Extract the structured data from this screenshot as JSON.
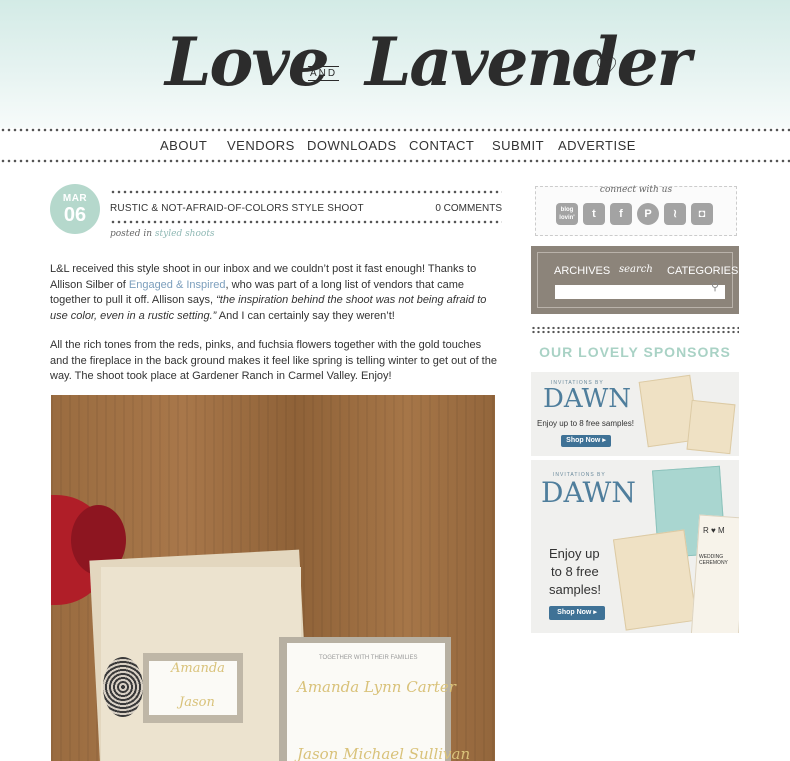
{
  "header": {
    "logo_left": "Love",
    "logo_and": "AND",
    "logo_right": "Lavender"
  },
  "nav": [
    "ABOUT",
    "VENDORS",
    "DOWNLOADS",
    "CONTACT",
    "SUBMIT",
    "ADVERTISE"
  ],
  "post": {
    "date_month": "MAR",
    "date_day": "06",
    "title": "RUSTIC & NOT-AFRAID-OF-COLORS STYLE SHOOT",
    "comments": "0 COMMENTS",
    "posted_in_label": "posted in",
    "category": "styled shoots",
    "p1_a": "L&L received this style shoot in our inbox and we couldn’t post it fast enough!  Thanks to Allison Silber of ",
    "p1_link": "Engaged & Inspired",
    "p1_b": ", who was part of a long list of vendors that came together to pull it off.  Allison says, ",
    "p1_quote": "“the inspiration behind the shoot was not being afraid to use color, even in a rustic setting.”",
    "p1_c": "  And I can certainly say they weren’t!",
    "p2": "All the rich tones from the reds, pinks, and fuchsia flowers together with the gold touches and the fireplace in the back ground makes it feel like spring is telling winter to get out of the way. The shoot took place at Gardener Ranch in Carmel Valley. Enjoy!",
    "photo_text": {
      "tag_name1": "Amanda",
      "tag_name2": "Jason",
      "card_small": "TOGETHER WITH THEIR FAMILIES",
      "card_name1": "Amanda Lynn Carter",
      "card_name2": "Jason Michael Sullivan"
    }
  },
  "sidebar": {
    "connect_title": "connect with us",
    "social": [
      {
        "icon": "bloglovin-icon",
        "glyph": "blog lovin'"
      },
      {
        "icon": "twitter-icon",
        "glyph": "t"
      },
      {
        "icon": "facebook-icon",
        "glyph": "f"
      },
      {
        "icon": "pinterest-icon",
        "glyph": "P"
      },
      {
        "icon": "rss-icon",
        "glyph": "≀"
      },
      {
        "icon": "instagram-icon",
        "glyph": "◘"
      }
    ],
    "tabs": [
      "ARCHIVES",
      "search",
      "CATEGORIES"
    ],
    "sponsors_title": "OUR LOVELY SPONSORS",
    "ad1": {
      "by": "INVITATIONS BY",
      "brand": "DAWN",
      "text": "Enjoy up to 8 free samples!",
      "button": "Shop Now ▸"
    },
    "ad2": {
      "by": "INVITATIONS BY",
      "brand": "DAWN",
      "text_l1": "Enjoy up",
      "text_l2": "to 8 free",
      "text_l3": "samples!",
      "button": "Shop Now ▸",
      "card_text_rm": "R ♥ M",
      "card_text_w": "WEDDING CEREMONY"
    }
  },
  "colors": {
    "accent": "#b5d8cc",
    "sponsor_title": "#a9d2c5",
    "search_bg": "#8c847a",
    "link": "#7b9ebc",
    "brand_dawn": "#4f7e9c"
  }
}
